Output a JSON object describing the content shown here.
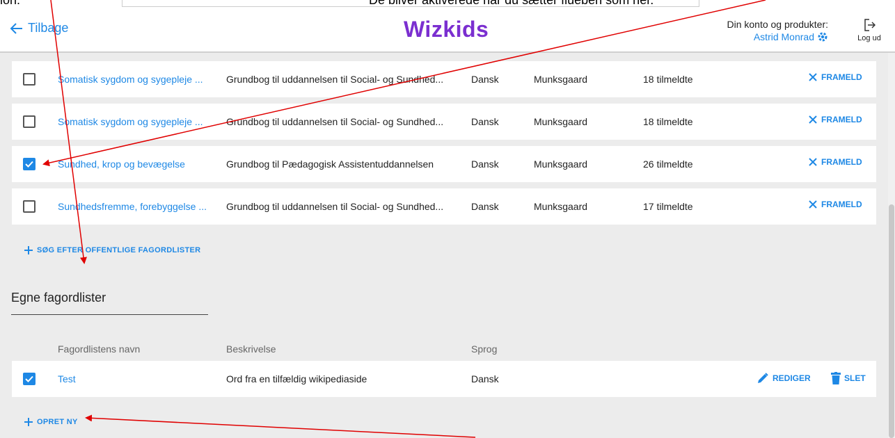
{
  "annotation": {
    "left_text": "ion.",
    "center_text": "De bliver aktiverede når du sætter flueben som her."
  },
  "header": {
    "back_label": "Tilbage",
    "logo": "Wizkids",
    "account_label": "Din konto og produkter:",
    "user_name": "Astrid Monrad",
    "logout_label": "Log ud"
  },
  "public_lists": {
    "rows": [
      {
        "checked": false,
        "name": "Somatisk sygdom og sygepleje ...",
        "description": "Grundbog til uddannelsen til Social- og Sundhed...",
        "language": "Dansk",
        "publisher": "Munksgaard",
        "count": "18 tilmeldte",
        "action": "FRAMELD"
      },
      {
        "checked": false,
        "name": "Somatisk sygdom og sygepleje ...",
        "description": "Grundbog til uddannelsen til Social- og Sundhed...",
        "language": "Dansk",
        "publisher": "Munksgaard",
        "count": "18 tilmeldte",
        "action": "FRAMELD"
      },
      {
        "checked": true,
        "name": "Sundhed, krop og bevægelse",
        "description": "Grundbog til Pædagogisk Assistentuddannelsen",
        "language": "Dansk",
        "publisher": "Munksgaard",
        "count": "26 tilmeldte",
        "action": "FRAMELD"
      },
      {
        "checked": false,
        "name": "Sundhedsfremme, forebyggelse ...",
        "description": "Grundbog til uddannelsen til Social- og Sundhed...",
        "language": "Dansk",
        "publisher": "Munksgaard",
        "count": "17 tilmeldte",
        "action": "FRAMELD"
      }
    ],
    "search_label": "SØG EFTER OFFENTLIGE FAGORDLISTER"
  },
  "own_lists": {
    "title": "Egne fagordlister",
    "columns": {
      "name": "Fagordlistens navn",
      "description": "Beskrivelse",
      "language": "Sprog"
    },
    "rows": [
      {
        "checked": true,
        "name": "Test",
        "description": "Ord fra en tilfældig wikipediaside",
        "language": "Dansk",
        "edit_label": "REDIGER",
        "delete_label": "SLET"
      }
    ],
    "create_label": "OPRET NY"
  },
  "colors": {
    "accent": "#1e88e5",
    "brand": "#7b2fd0",
    "annotation_arrow": "#e00000"
  },
  "icons": [
    "arrow-left-icon",
    "gear-icon",
    "logout-icon",
    "close-icon",
    "plus-icon",
    "pencil-icon",
    "trash-icon",
    "checkbox-icon"
  ]
}
